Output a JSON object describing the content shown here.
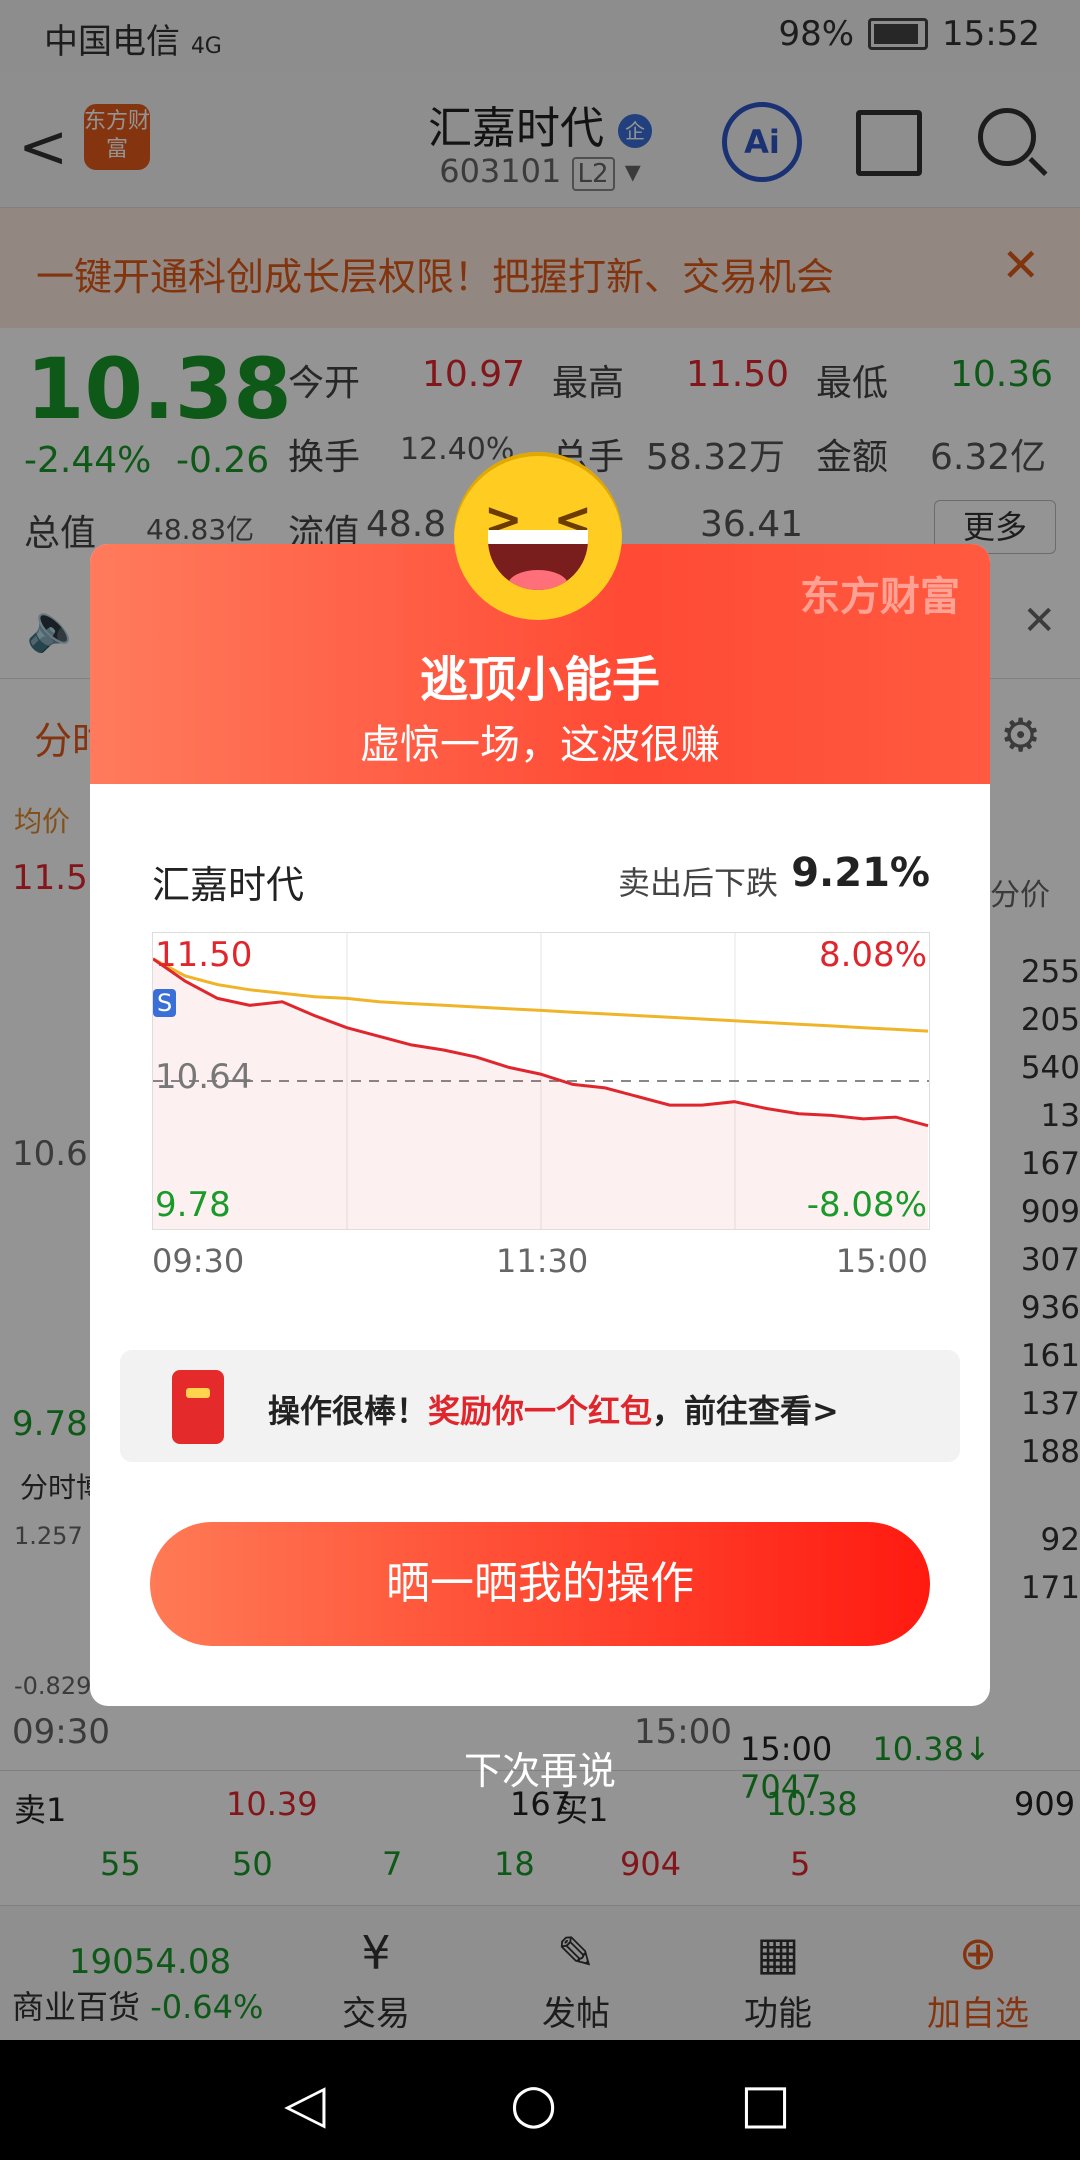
{
  "status_bar": {
    "carrier": "中国电信",
    "network": "4G",
    "battery": "98%",
    "time": "15:52"
  },
  "header": {
    "back": "<",
    "logo": "东方财富",
    "stock_name": "汇嘉时代",
    "badge": "企",
    "stock_code": "603101",
    "level": "L2",
    "ai": "Ai"
  },
  "promo": {
    "text": "一键开通科创成长层权限！把握打新、交易机会",
    "close": "✕"
  },
  "quote": {
    "price": "10.38",
    "change_pct": "-2.44%",
    "change": "-0.26",
    "open_label": "今开",
    "open": "10.97",
    "high_label": "最高",
    "high": "11.50",
    "low_label": "最低",
    "low": "10.36",
    "turnover_label": "换手",
    "turnover": "12.40%",
    "volume_label": "总手",
    "volume": "58.32万",
    "amount_label": "金额",
    "amount": "6.32亿",
    "mktcap_label": "总值",
    "mktcap": "48.83亿",
    "float_label": "流值",
    "float": "48.8",
    "pe": "36.41",
    "more": "更多"
  },
  "background": {
    "tab": "分时",
    "avg_label": "均价",
    "hi": "11.5",
    "mid": "10.6",
    "lo": "9.78",
    "sub_label": "分时博",
    "sub_hi": "1.257",
    "sub_lo": "-0.829",
    "t_start": "09:30",
    "t_end": "15:00",
    "right_label": "分价",
    "right_values": [
      "255",
      "205",
      "540",
      "13",
      "167",
      "909",
      "307",
      "936",
      "161",
      "137",
      "188",
      "92",
      "171"
    ],
    "last_row": {
      "time": "15:00",
      "price": "10.38↓",
      "vol": "7047"
    },
    "sell1_label": "卖1",
    "sell1_price": "10.39",
    "sell1_vol": "167",
    "buy1_label": "买1",
    "buy1_price": "10.38",
    "buy1_vol": "909",
    "row2": [
      "55",
      "50",
      "7",
      "18",
      "904",
      "5"
    ]
  },
  "modal": {
    "watermark": "东方财富",
    "title": "逃顶小能手",
    "subtitle": "虚惊一场，这波很赚",
    "stock": "汇嘉时代",
    "drop_label": "卖出后下跌",
    "drop_value": "9.21%",
    "chart_labels": {
      "hi": "11.50",
      "pre": "10.64",
      "lo": "9.78",
      "hi_pct": "8.08%",
      "lo_pct": "-8.08%",
      "s_mark": "S"
    },
    "times": [
      "09:30",
      "11:30",
      "15:00"
    ],
    "reward_a": "操作很棒！",
    "reward_b": "奖励你一个红包",
    "reward_c": "，前往查看>",
    "share_button": "晒一晒我的操作",
    "dismiss": "下次再说"
  },
  "chart_data": {
    "type": "line",
    "x": [
      "09:30",
      "11:30",
      "15:00"
    ],
    "ylim": [
      9.78,
      11.5
    ],
    "pre_close": 10.64,
    "series": [
      {
        "values": [
          11.35,
          11.22,
          11.12,
          11.08,
          11.1,
          11.02,
          10.95,
          10.9,
          10.85,
          10.82,
          10.78,
          10.72,
          10.68,
          10.62,
          10.6,
          10.55,
          10.5,
          10.5,
          10.52,
          10.48,
          10.45,
          10.44,
          10.42,
          10.43,
          10.38
        ]
      },
      {
        "values": [
          11.35,
          11.25,
          11.2,
          11.17,
          11.15,
          11.13,
          11.12,
          11.1,
          11.09,
          11.08,
          11.07,
          11.06,
          11.05,
          11.04,
          11.03,
          11.02,
          11.01,
          11.0,
          10.99,
          10.98,
          10.97,
          10.96,
          10.95,
          10.94,
          10.93
        ]
      }
    ],
    "colors": {
      "price": "#e0262d",
      "avg": "#f0b429"
    }
  },
  "bottom_tabs": {
    "index_value": "19054.08",
    "index_name": "商业百货",
    "index_change": "-0.64%",
    "trade": "交易",
    "post": "发帖",
    "func": "功能",
    "add": "加自选"
  }
}
